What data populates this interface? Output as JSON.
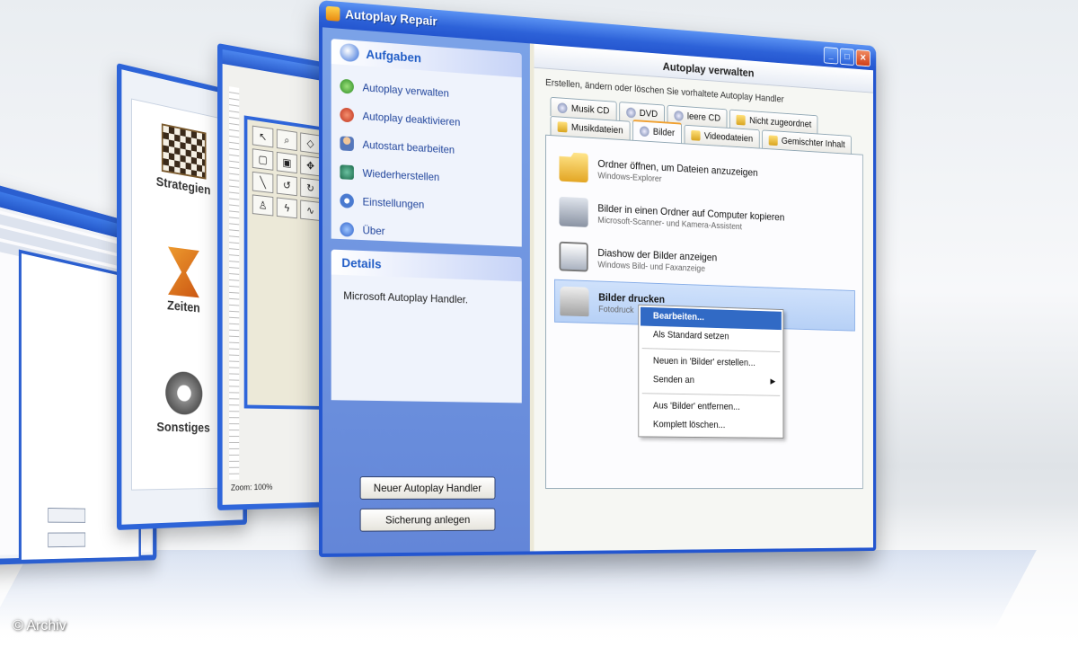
{
  "main_window": {
    "title": "Autoplay Repair",
    "controls": {
      "minimize": "_",
      "maximize": "□",
      "close": "✕"
    }
  },
  "task_pane": {
    "tasks_header": "Aufgaben",
    "tasks": [
      {
        "label": "Autoplay verwalten",
        "icon": "autoplay-icon"
      },
      {
        "label": "Autoplay deaktivieren",
        "icon": "disable-icon"
      },
      {
        "label": "Autostart bearbeiten",
        "icon": "autostart-icon"
      },
      {
        "label": "Wiederherstellen",
        "icon": "restore-icon"
      },
      {
        "label": "Einstellungen",
        "icon": "settings-icon"
      },
      {
        "label": "Über",
        "icon": "info-icon"
      }
    ],
    "details_header": "Details",
    "details_text": "Microsoft Autoplay Handler.",
    "buttons": {
      "new_handler": "Neuer Autoplay Handler",
      "backup": "Sicherung anlegen"
    }
  },
  "content": {
    "header": "Autoplay verwalten",
    "description": "Erstellen, ändern oder löschen Sie vorhaltete Autoplay Handler",
    "tabs_row1": [
      "Musik CD",
      "DVD",
      "leere CD",
      "Nicht zugeordnet"
    ],
    "tabs_row2": [
      "Musikdateien",
      "Bilder",
      "Videodateien",
      "Gemischter Inhalt"
    ],
    "active_tab": "Bilder",
    "handlers": [
      {
        "title": "Ordner öffnen, um Dateien anzuzeigen",
        "subtitle": "Windows-Explorer"
      },
      {
        "title": "Bilder in einen Ordner auf Computer kopieren",
        "subtitle": "Microsoft-Scanner- und Kamera-Assistent"
      },
      {
        "title": "Diashow der Bilder anzeigen",
        "subtitle": "Windows Bild- und Faxanzeige"
      },
      {
        "title": "Bilder drucken",
        "subtitle": "Fotodruck"
      }
    ],
    "context_menu": [
      "Bearbeiten...",
      "Als Standard setzen",
      "Neuen in 'Bilder' erstellen...",
      "Senden an",
      "Aus 'Bilder' entfernen...",
      "Komplett löschen..."
    ]
  },
  "back_windows": {
    "categories": [
      "Strategien",
      "Zeiten",
      "Sonstiges"
    ],
    "zoom": "Zoom: 100%"
  },
  "copyright": "© Archiv"
}
